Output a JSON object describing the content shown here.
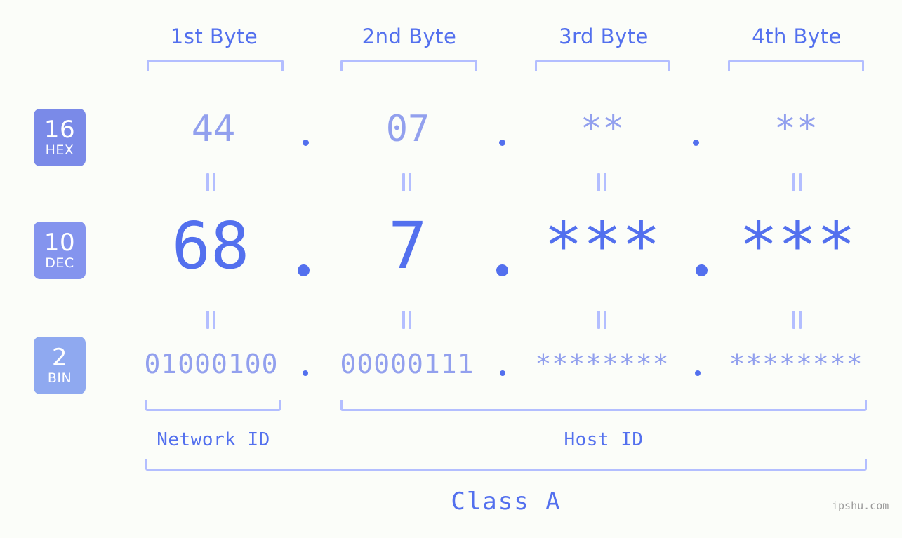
{
  "bytes": {
    "headers": [
      {
        "label": "1st Byte"
      },
      {
        "label": "2nd Byte"
      },
      {
        "label": "3rd Byte"
      },
      {
        "label": "4th Byte"
      }
    ]
  },
  "radix_badges": [
    {
      "number": "16",
      "name": "HEX",
      "color": "#7a8ae8"
    },
    {
      "number": "10",
      "name": "DEC",
      "color": "#8494ee"
    },
    {
      "number": "2",
      "name": "BIN",
      "color": "#8fa9f0"
    }
  ],
  "rows": {
    "hex": {
      "values": [
        "44",
        "07",
        "**",
        "**"
      ],
      "separator": "."
    },
    "dec": {
      "values": [
        "68",
        "7",
        "***",
        "***"
      ],
      "separator": "."
    },
    "bin": {
      "values": [
        "01000100",
        "00000111",
        "********",
        "********"
      ],
      "separator": "."
    }
  },
  "separators": {
    "equals": "||"
  },
  "sections": {
    "network_id": "Network ID",
    "host_id": "Host ID",
    "class": "Class A"
  },
  "watermark": "ipshu.com",
  "colors": {
    "background": "#fbfdf9",
    "accent": "#5370ee",
    "muted": "#92a0ee",
    "bracket": "#b3beff"
  }
}
